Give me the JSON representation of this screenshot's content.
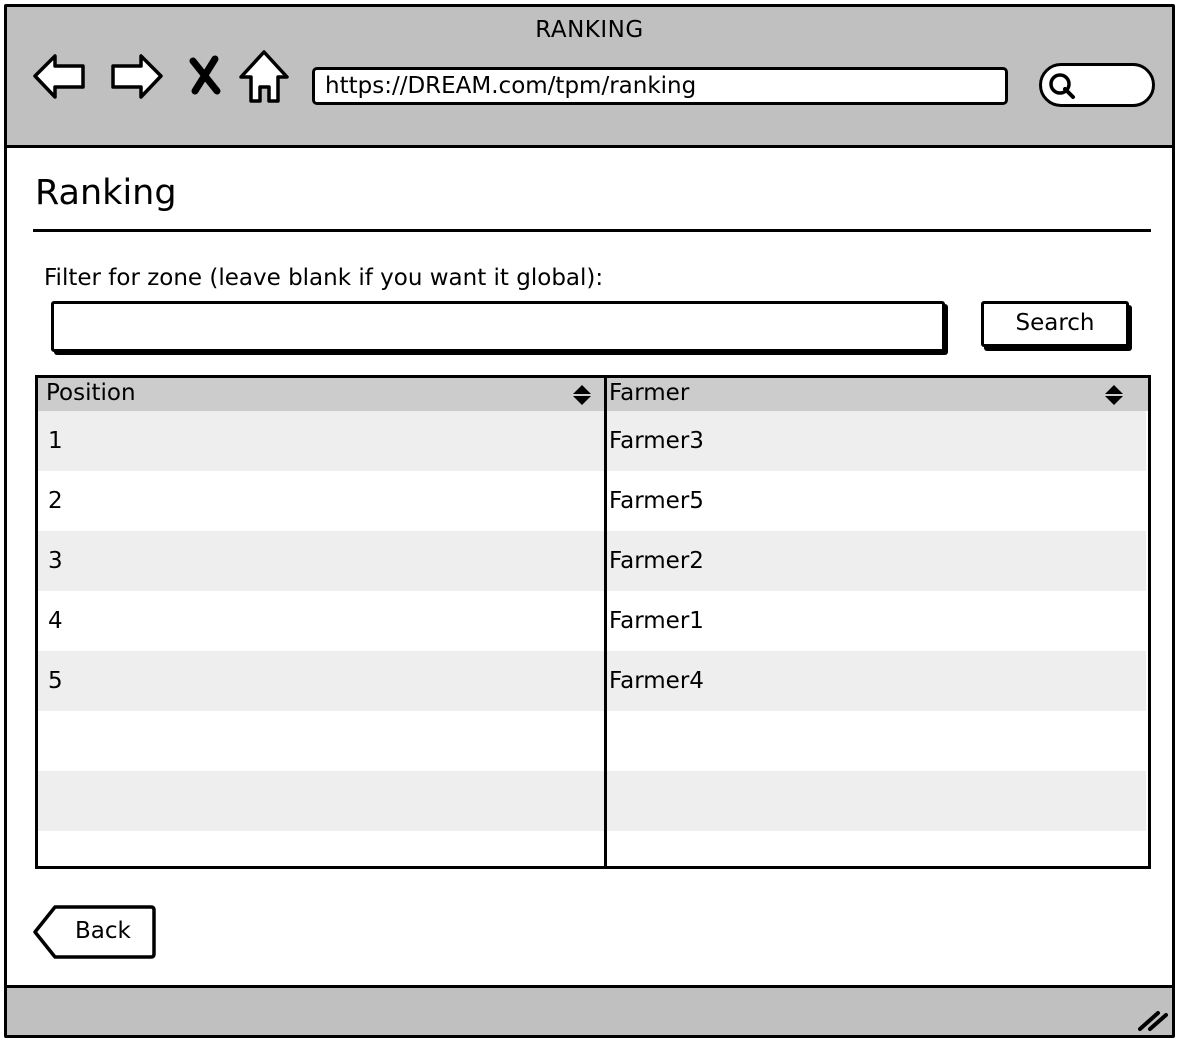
{
  "window": {
    "title": "RANKING",
    "url": "https://DREAM.com/tpm/ranking"
  },
  "nav": {
    "back_icon": "arrow-left-icon",
    "forward_icon": "arrow-right-icon",
    "close_icon": "close-icon",
    "home_icon": "home-icon",
    "search_icon": "search-icon"
  },
  "page": {
    "title": "Ranking",
    "filter_label": "Filter for zone (leave blank if you want it global):",
    "filter_value": "",
    "search_label": "Search",
    "back_label": "Back"
  },
  "table": {
    "columns": [
      "Position",
      "Farmer"
    ],
    "rows": [
      [
        "1",
        "Farmer3"
      ],
      [
        "2",
        "Farmer5"
      ],
      [
        "3",
        "Farmer2"
      ],
      [
        "4",
        "Farmer1"
      ],
      [
        "5",
        "Farmer4"
      ],
      [
        "",
        ""
      ],
      [
        "",
        ""
      ],
      [
        "",
        ""
      ]
    ]
  },
  "colors": {
    "chrome": "#c0c0c0",
    "table_header": "#cccccc",
    "row_alt": "#eeeeee"
  }
}
